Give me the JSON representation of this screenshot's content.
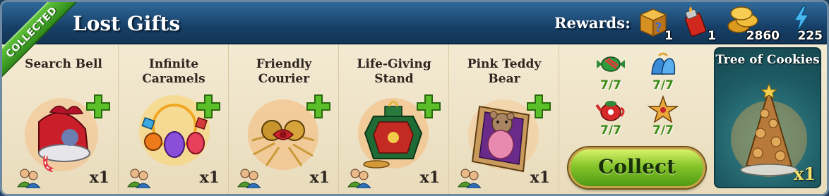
{
  "header": {
    "title": "Lost Gifts",
    "rewards_label": "Rewards:",
    "rewards": [
      {
        "icon": "mystery-box-icon",
        "count": "1"
      },
      {
        "icon": "red-lighter-icon",
        "count": "1"
      },
      {
        "icon": "gold-coins-icon",
        "count": "2860"
      },
      {
        "icon": "energy-bolt-icon",
        "count": "225"
      }
    ]
  },
  "ribbon": "COLLECTED",
  "items": [
    {
      "name": "Search Bell",
      "multiplier": "x1"
    },
    {
      "name": "Infinite Caramels",
      "multiplier": "x1"
    },
    {
      "name": "Friendly Courier",
      "multiplier": "x1"
    },
    {
      "name": "Life-Giving Stand",
      "multiplier": "x1"
    },
    {
      "name": "Pink Teddy Bear",
      "multiplier": "x1"
    }
  ],
  "components": [
    {
      "icon": "candy-icon",
      "count": "7/7"
    },
    {
      "icon": "bells-icon",
      "count": "7/7"
    },
    {
      "icon": "teapot-icon",
      "count": "7/7"
    },
    {
      "icon": "star-ornament-icon",
      "count": "7/7"
    }
  ],
  "collect_label": "Collect",
  "final_reward": {
    "name": "Tree of Cookies",
    "multiplier": "x1"
  },
  "colors": {
    "header": "#174068",
    "content": "#f3ead3",
    "ribbon": "#4aa82a",
    "button": "#86c52b",
    "final_bg": "#1d5a63"
  }
}
